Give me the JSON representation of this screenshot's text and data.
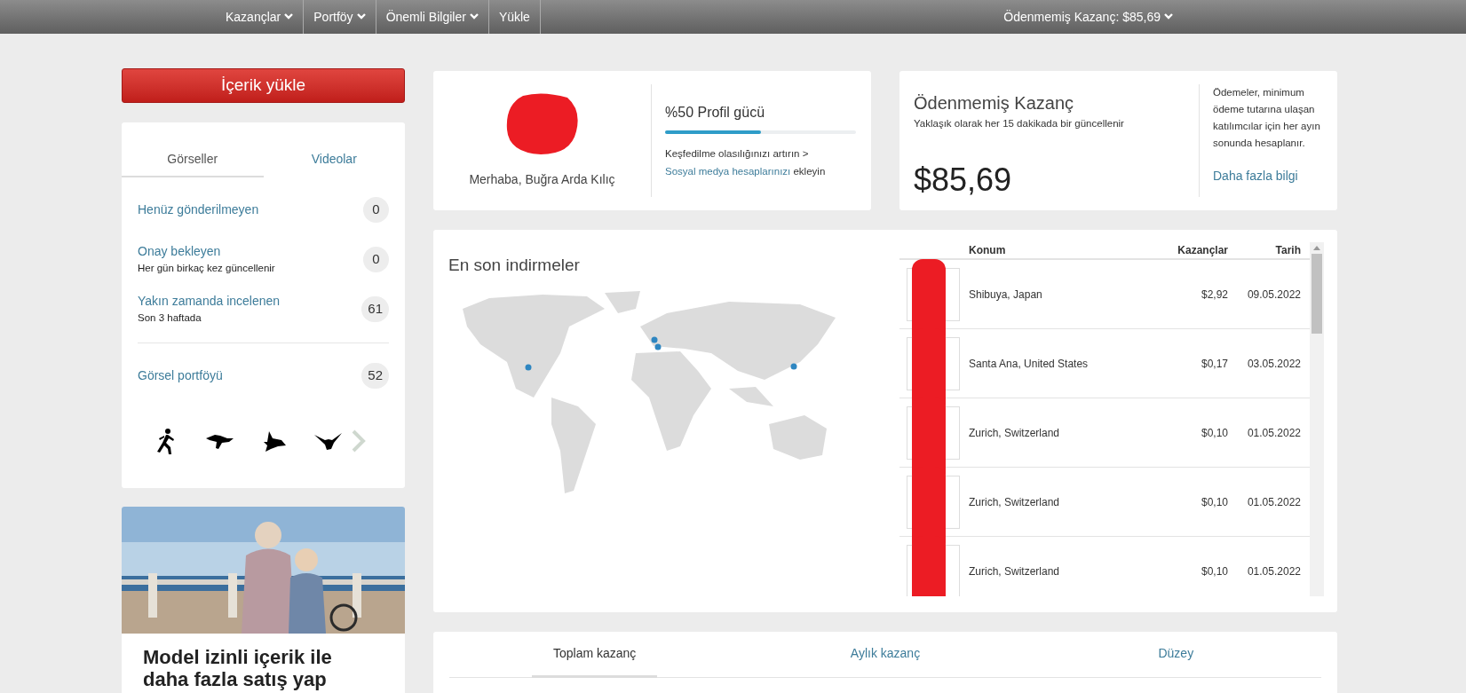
{
  "nav": {
    "items": [
      {
        "label": "Kazançlar",
        "dropdown": true
      },
      {
        "label": "Portföy",
        "dropdown": true
      },
      {
        "label": "Önemli Bilgiler",
        "dropdown": true
      },
      {
        "label": "Yükle",
        "dropdown": false
      }
    ],
    "account": {
      "label": "Ödenmemiş Kazanç: $85,69",
      "dropdown": true
    }
  },
  "upload_button": "İçerik yükle",
  "content_tabs": [
    {
      "label": "Görseller",
      "selected": true
    },
    {
      "label": "Videolar",
      "selected": false
    }
  ],
  "stats": [
    {
      "label": "Henüz gönderilmeyen",
      "count": "0"
    },
    {
      "label": "Onay bekleyen",
      "note": "Her gün birkaç kez güncellenir",
      "count": "0"
    },
    {
      "label": "Yakın zamanda incelenen",
      "note": "Son 3 haftada",
      "count": "61"
    }
  ],
  "portfolio": {
    "label": "Görsel portföyü",
    "count": "52"
  },
  "promo": {
    "kind": "picture",
    "headline": "Model izinli içerik ile daha fazla satış yap"
  },
  "profile": {
    "greeting": "Merhaba, Buğra Arda Kılıç",
    "strength": "%50 Profil gücü",
    "level": 0.5,
    "tip": "Keşfedilme olasılığınızı artırın > ",
    "tip_link": "Sosyal medya hesaplarınızı",
    "tip_end": " ekleyin"
  },
  "earnings": {
    "title": "Ödenmemiş Kazanç",
    "subtitle": "Yaklaşık olarak her 15 dakikada bir güncellenir",
    "amount": "$85,69",
    "note": "Ödemeler, minimum ödeme tutarına ulaşan katılımcılar için her ayın sonunda hesaplanır.",
    "link": "Daha fazla bilgi"
  },
  "downloads": {
    "title": "En son indirmeler",
    "columns": [
      "Konum",
      "Kazançlar",
      "Tarih"
    ],
    "rows": [
      {
        "location": "Shibuya, Japan",
        "earnings": "$2,92",
        "date": "09.05.2022"
      },
      {
        "location": "Santa Ana, United States",
        "earnings": "$0,17",
        "date": "03.05.2022"
      },
      {
        "location": "Zurich, Switzerland",
        "earnings": "$0,10",
        "date": "01.05.2022"
      },
      {
        "location": "Zurich, Switzerland",
        "earnings": "$0,10",
        "date": "01.05.2022"
      },
      {
        "location": "Zurich, Switzerland",
        "earnings": "$0,10",
        "date": "01.05.2022"
      }
    ]
  },
  "bottom_tabs": [
    {
      "label": "Toplam kazanç",
      "selected": true
    },
    {
      "label": "Aylık kazanç",
      "selected": false
    },
    {
      "label": "Düzey",
      "selected": false
    }
  ]
}
